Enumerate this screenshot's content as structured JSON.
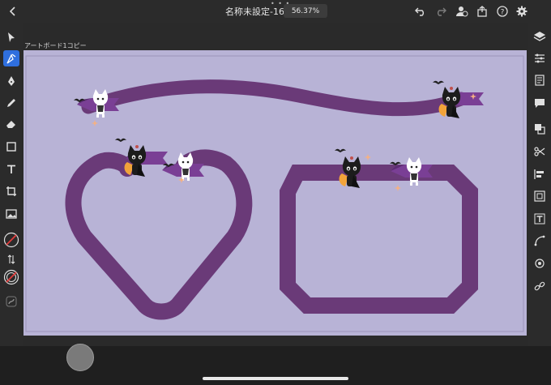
{
  "document": {
    "title": "名称未設定-164",
    "zoom": "56.37%"
  },
  "artboard": {
    "label": "アートボード1コピー"
  },
  "colors": {
    "toolbar_bg": "#2b2b2b",
    "artboard_bg": "#b8b3d6",
    "path_purple": "#6a3a78",
    "accent_blue": "#2f6fde"
  },
  "toolbar_left": [
    "select-tool",
    "direct-select-tool",
    "pen-tool",
    "pencil-tool",
    "eraser-tool",
    "rectangle-tool",
    "text-tool",
    "crop-tool",
    "image-tool",
    "fill-swatch",
    "swap-colors",
    "stroke-swatch",
    "path-tool"
  ],
  "toolbar_right": [
    "layers-icon",
    "properties-icon",
    "libraries-icon",
    "comments-icon",
    "duplicate-icon",
    "scissors-icon",
    "align-icon",
    "grid-icon",
    "type-icon",
    "curve-icon",
    "settings-icon",
    "link-icon"
  ]
}
